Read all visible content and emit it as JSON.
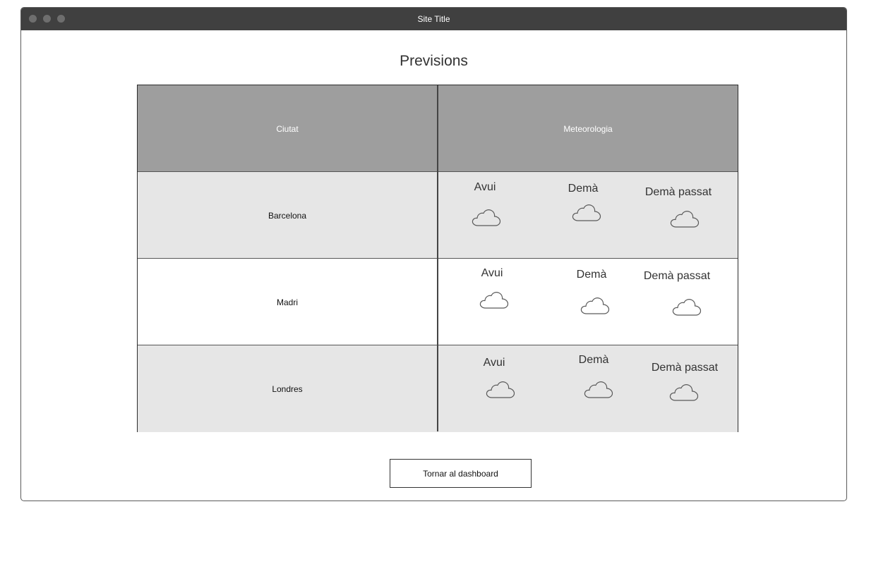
{
  "window": {
    "title": "Site Title"
  },
  "page": {
    "title": "Previsions"
  },
  "table": {
    "headers": {
      "city": "Ciutat",
      "weather": "Meteorologia"
    },
    "rows": [
      {
        "city": "Barcelona",
        "days": [
          {
            "label": "Avui",
            "icon": "cloud-icon"
          },
          {
            "label": "Demà",
            "icon": "cloud-icon"
          },
          {
            "label": "Demà passat",
            "icon": "cloud-icon"
          }
        ]
      },
      {
        "city": "Madri",
        "days": [
          {
            "label": "Avui",
            "icon": "cloud-icon"
          },
          {
            "label": "Demà",
            "icon": "cloud-icon"
          },
          {
            "label": "Demà passat",
            "icon": "cloud-icon"
          }
        ]
      },
      {
        "city": "Londres",
        "days": [
          {
            "label": "Avui",
            "icon": "cloud-icon"
          },
          {
            "label": "Demà",
            "icon": "cloud-icon"
          },
          {
            "label": "Demà passat",
            "icon": "cloud-icon"
          }
        ]
      }
    ]
  },
  "actions": {
    "back_label": "Tornar al dashboard"
  },
  "colors": {
    "titlebar": "#404040",
    "header_row": "#9e9e9e",
    "shaded_row": "#e6e6e6"
  }
}
